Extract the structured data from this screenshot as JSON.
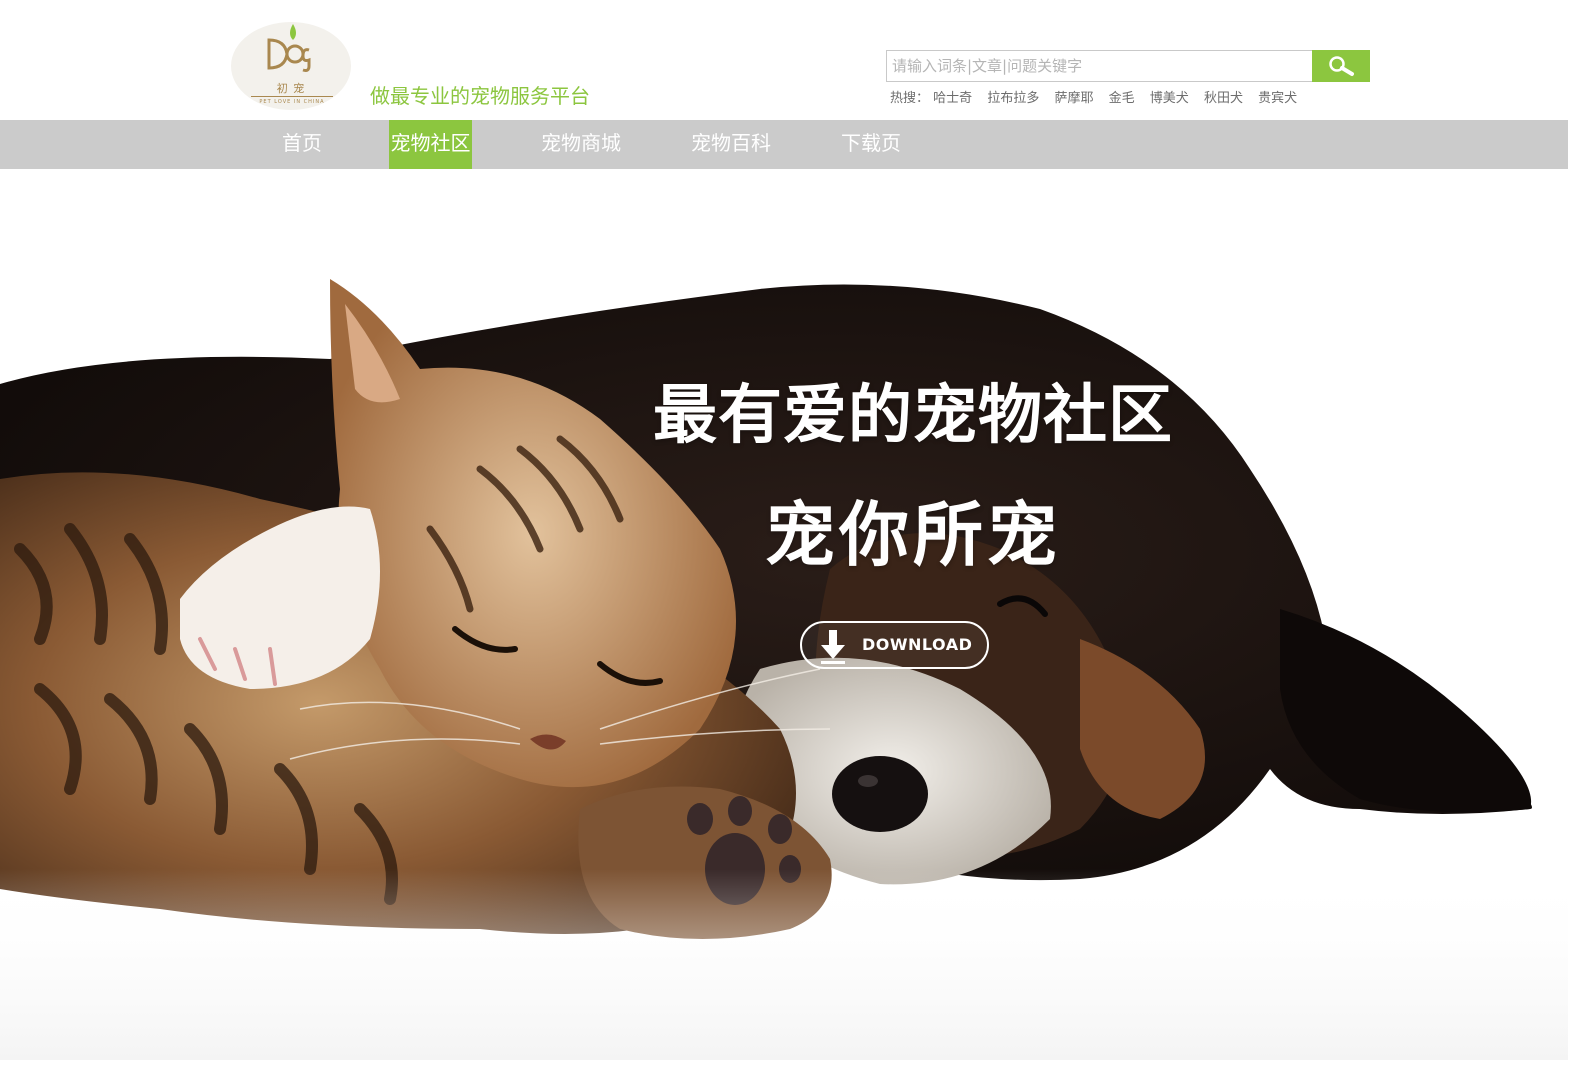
{
  "logo": {
    "mark": "Dog",
    "caption": "初 宠",
    "tagline": "PET LOVE IN CHINA"
  },
  "header": {
    "slogan": "做最专业的宠物服务平台"
  },
  "search": {
    "placeholder": "请输入词条|文章|问题关键字",
    "button_icon": "search-icon",
    "hot_label": "热搜：",
    "hot_keywords": [
      "哈士奇",
      "拉布拉多",
      "萨摩耶",
      "金毛",
      "博美犬",
      "秋田犬",
      "贵宾犬"
    ]
  },
  "nav": {
    "items": [
      {
        "label": "首页",
        "active": false
      },
      {
        "label": "宠物社区",
        "active": true
      },
      {
        "label": "宠物商城",
        "active": false
      },
      {
        "label": "宠物百科",
        "active": false
      },
      {
        "label": "下载页",
        "active": false
      }
    ]
  },
  "hero": {
    "title": "最有爱的宠物社区",
    "subtitle": "宠你所宠",
    "download_label": "DOWNLOAD",
    "download_icon": "arrow-down-icon"
  },
  "colors": {
    "accent": "#8cc63f",
    "nav_bg": "#cbcbcb",
    "logo_gold": "#a9884f"
  }
}
